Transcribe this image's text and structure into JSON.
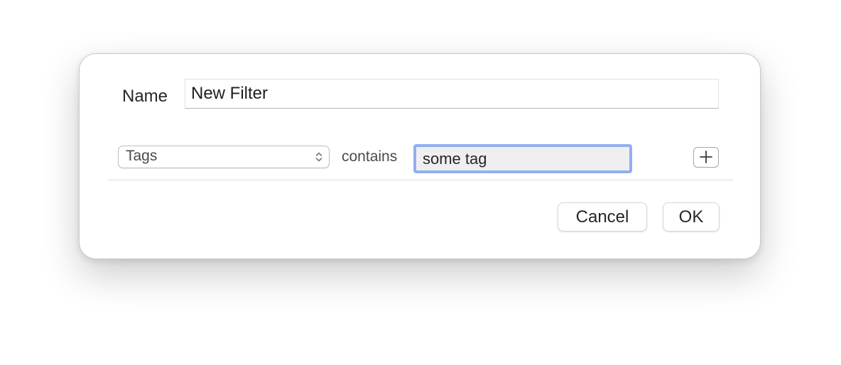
{
  "dialog": {
    "name_label": "Name",
    "name_value": "New Filter",
    "rule": {
      "field": "Tags",
      "operator": "contains",
      "value": "some tag",
      "add_icon": "plus-icon",
      "field_icon": "up-down-chevron-icon"
    },
    "buttons": {
      "cancel": "Cancel",
      "ok": "OK"
    },
    "colors": {
      "focus_ring": "#92aef2",
      "value_field_bg": "#efefef"
    }
  }
}
